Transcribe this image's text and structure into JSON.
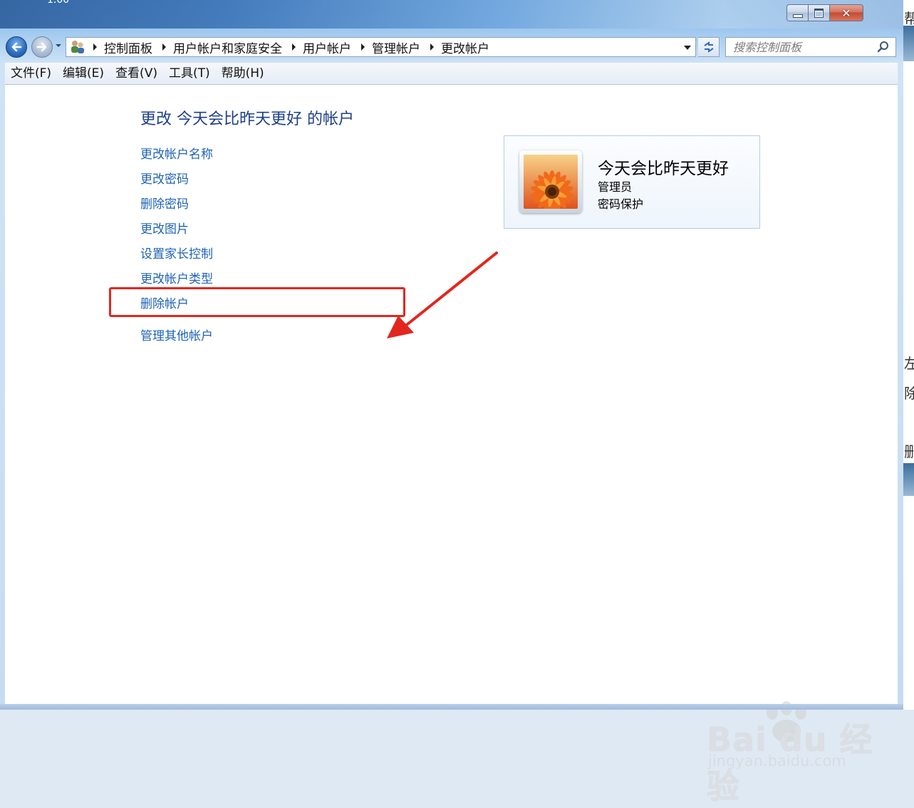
{
  "window": {
    "corner_title_fragment": "1.00"
  },
  "caption_buttons": {
    "minimize_icon": "minimize-icon",
    "maximize_icon": "maximize-icon",
    "close_icon": "close-icon",
    "close_glyph": "✕"
  },
  "navigation": {
    "back_icon": "back-arrow-icon",
    "forward_icon": "forward-arrow-icon"
  },
  "address_bar": {
    "breadcrumbs": [
      "控制面板",
      "用户帐户和家庭安全",
      "用户帐户",
      "管理帐户",
      "更改帐户"
    ]
  },
  "search": {
    "placeholder": "搜索控制面板"
  },
  "menu": {
    "items": [
      "文件(F)",
      "编辑(E)",
      "查看(V)",
      "工具(T)",
      "帮助(H)"
    ]
  },
  "main": {
    "title": "更改 今天会比昨天更好 的帐户",
    "tasks": [
      "更改帐户名称",
      "更改密码",
      "删除密码",
      "更改图片",
      "设置家长控制",
      "更改帐户类型",
      "删除帐户"
    ],
    "other_link": "管理其他帐户",
    "highlighted_task": "删除帐户"
  },
  "account": {
    "name": "今天会比昨天更好",
    "type": "管理员",
    "status": "密码保护"
  },
  "background_fragments": [
    "帮",
    "左",
    "除",
    "删"
  ],
  "watermark": {
    "brand": "Bai du 经验",
    "url": "jingyan.baidu.com"
  },
  "colors": {
    "link": "#1e63b5",
    "title": "#1e3f8b",
    "annotation": "#e2261e"
  }
}
